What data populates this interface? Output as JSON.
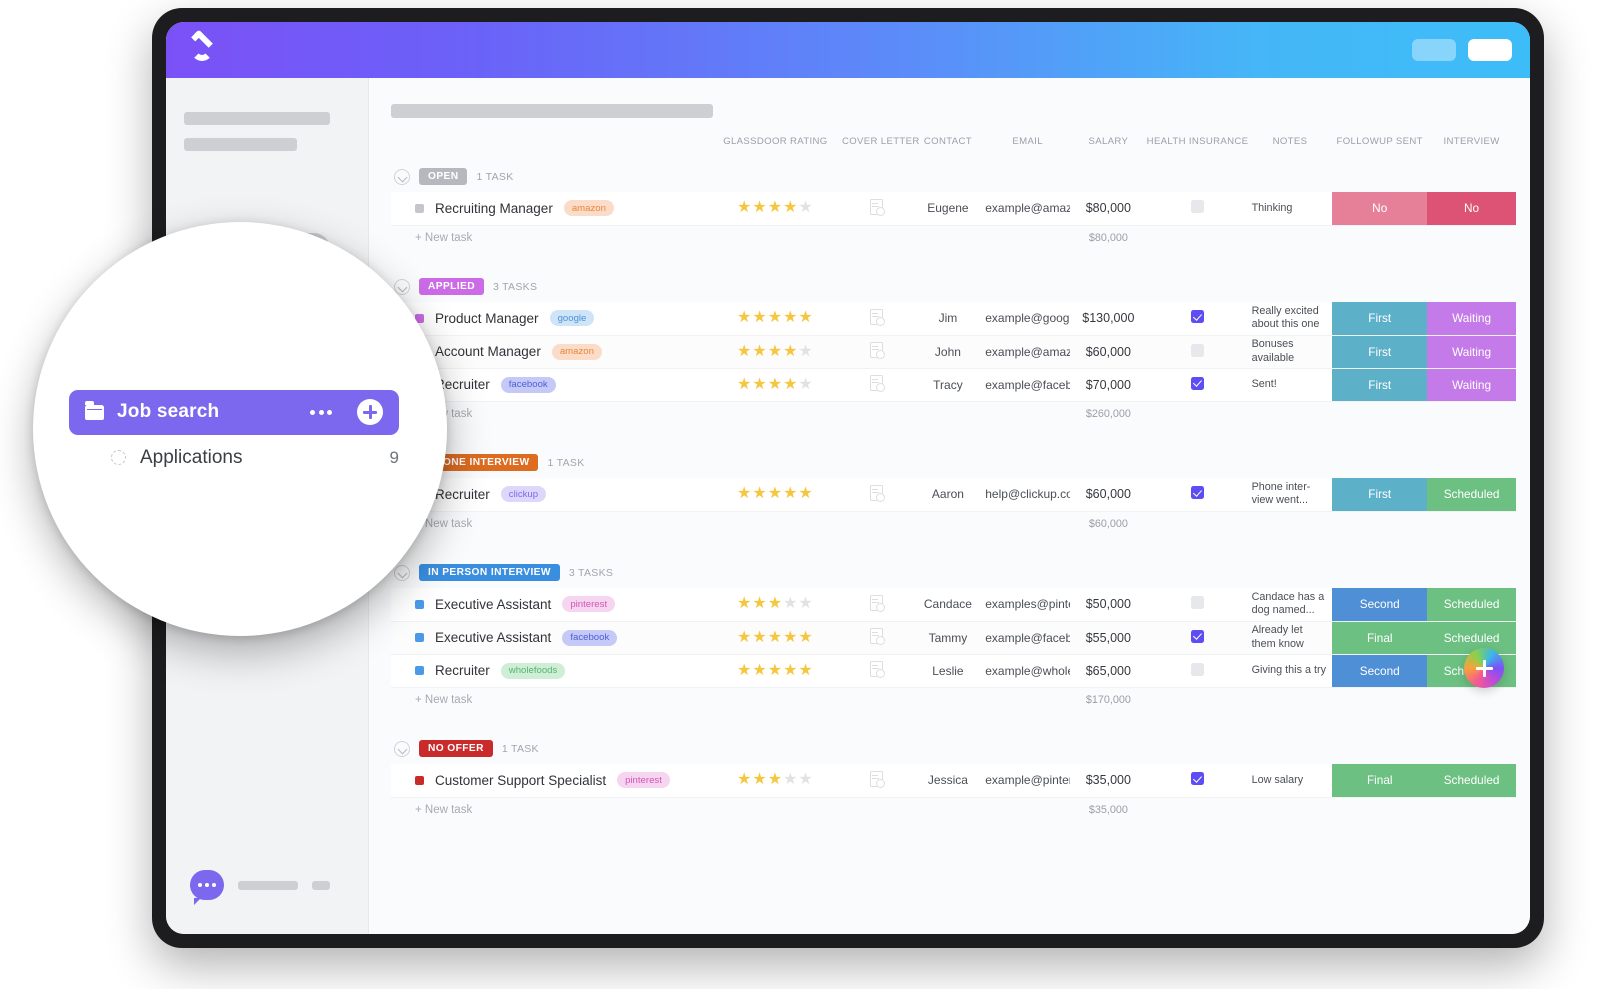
{
  "app": {
    "logo_name": "clickup-logo"
  },
  "topbar": {
    "buttons": [
      "",
      ""
    ]
  },
  "sidebar": {
    "placeholders": [
      "",
      "",
      ""
    ],
    "chat_label": ""
  },
  "table": {
    "columns": [
      "",
      "GLASSDOOR RATING",
      "COVER LETTER",
      "CONTACT",
      "EMAIL",
      "SALARY",
      "HEALTH INSURANCE",
      "NOTES",
      "FOLLOWUP SENT",
      "INTERVIEW"
    ],
    "new_task_label": "+ New task",
    "groups": [
      {
        "name": "OPEN",
        "badge_color": "#b5b9bf",
        "bullet_color": "#c3c7cc",
        "count_label": "1 TASK",
        "subtotal": "$80,000",
        "rows": [
          {
            "task": "Recruiting Manager",
            "tag": "amazon",
            "tag_bg": "#fbdcc8",
            "tag_fg": "#e8873a",
            "rating": 4,
            "contact": "Eugene",
            "email": "example@amazon.com",
            "salary": "$80,000",
            "insurance": false,
            "notes": "Thinking",
            "followup": "No",
            "followup_color": "#e58098",
            "interview": "No",
            "interview_color": "#dd5375"
          }
        ]
      },
      {
        "name": "APPLIED",
        "badge_color": "#cb6ce6",
        "bullet_color": "#cb6ce6",
        "count_label": "3 TASKS",
        "subtotal": "$260,000",
        "rows": [
          {
            "task": "Product Manager",
            "tag": "google",
            "tag_bg": "#cfe4f7",
            "tag_fg": "#4b93d8",
            "rating": 5,
            "contact": "Jim",
            "email": "example@google.com",
            "salary": "$130,000",
            "insurance": true,
            "notes": "Really excited about this one",
            "followup": "First",
            "followup_color": "#5cb1c9",
            "interview": "Waiting",
            "interview_color": "#c47ae8"
          },
          {
            "task": "Account Manager",
            "tag": "amazon",
            "tag_bg": "#fbdcc8",
            "tag_fg": "#e8873a",
            "rating": 4,
            "contact": "John",
            "email": "example@amazon.com",
            "salary": "$60,000",
            "insurance": false,
            "notes": "Bonuses available",
            "followup": "First",
            "followup_color": "#5cb1c9",
            "interview": "Waiting",
            "interview_color": "#c47ae8"
          },
          {
            "task": "Recruiter",
            "tag": "facebook",
            "tag_bg": "#c5c9f7",
            "tag_fg": "#4c61d6",
            "rating": 4,
            "contact": "Tracy",
            "email": "example@facebook.com",
            "salary": "$70,000",
            "insurance": true,
            "notes": "Sent!",
            "followup": "First",
            "followup_color": "#5cb1c9",
            "interview": "Waiting",
            "interview_color": "#c47ae8"
          }
        ]
      },
      {
        "name": "PHONE INTERVIEW",
        "badge_color": "#dd6b20",
        "bullet_color": "#dd6b20",
        "count_label": "1 TASK",
        "subtotal": "$60,000",
        "rows": [
          {
            "task": "Recruiter",
            "tag": "clickup",
            "tag_bg": "#ddd8fb",
            "tag_fg": "#7b68ee",
            "rating": 5,
            "contact": "Aaron",
            "email": "help@clickup.com",
            "salary": "$60,000",
            "insurance": true,
            "notes": "Phone inter-view went...",
            "followup": "First",
            "followup_color": "#5cb1c9",
            "interview": "Scheduled",
            "interview_color": "#6cc082"
          }
        ]
      },
      {
        "name": "IN PERSON INTERVIEW",
        "badge_color": "#3a8ee0",
        "bullet_color": "#4a9ae8",
        "count_label": "3 TASKS",
        "subtotal": "$170,000",
        "rows": [
          {
            "task": "Executive Assistant",
            "tag": "pinterest",
            "tag_bg": "#f6d5f0",
            "tag_fg": "#d257b5",
            "rating": 3,
            "contact": "Candace",
            "email": "examples@pinterest.com",
            "salary": "$50,000",
            "insurance": false,
            "notes": "Candace has a dog named...",
            "followup": "Second",
            "followup_color": "#4e8fd6",
            "interview": "Scheduled",
            "interview_color": "#6cc082"
          },
          {
            "task": "Executive Assistant",
            "tag": "facebook",
            "tag_bg": "#c5c9f7",
            "tag_fg": "#4c61d6",
            "rating": 5,
            "contact": "Tammy",
            "email": "example@facebook.com",
            "salary": "$55,000",
            "insurance": true,
            "notes": "Already let them know",
            "followup": "Final",
            "followup_color": "#6cc082",
            "interview": "Scheduled",
            "interview_color": "#6cc082"
          },
          {
            "task": "Recruiter",
            "tag": "wholefoods",
            "tag_bg": "#cfeed6",
            "tag_fg": "#56b36f",
            "rating": 5,
            "contact": "Leslie",
            "email": "example@wholefoods.com",
            "salary": "$65,000",
            "insurance": false,
            "notes": "Giving this a try",
            "followup": "Second",
            "followup_color": "#4e8fd6",
            "interview": "Scheduled",
            "interview_color": "#6cc082"
          }
        ]
      },
      {
        "name": "NO OFFER",
        "badge_color": "#c92a2a",
        "bullet_color": "#c92a2a",
        "count_label": "1 TASK",
        "subtotal": "$35,000",
        "rows": [
          {
            "task": "Customer Support Specialist",
            "tag": "pinterest",
            "tag_bg": "#f6d5f0",
            "tag_fg": "#d257b5",
            "rating": 3,
            "contact": "Jessica",
            "email": "example@pinterest.com",
            "salary": "$35,000",
            "insurance": true,
            "notes": "Low salary",
            "followup": "Final",
            "followup_color": "#6cc082",
            "interview": "Scheduled",
            "interview_color": "#6cc082"
          }
        ]
      }
    ]
  },
  "magnifier": {
    "folder_label": "Job search",
    "sub_label": "Applications",
    "sub_count": "9"
  },
  "fab": {
    "label": "+"
  }
}
